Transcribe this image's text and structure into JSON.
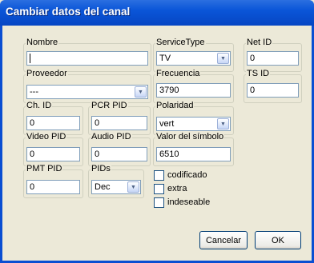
{
  "window": {
    "title": "Cambiar datos del canal"
  },
  "fields": {
    "nombre": {
      "label": "Nombre",
      "value": ""
    },
    "service_type": {
      "label": "ServiceType",
      "value": "TV"
    },
    "net_id": {
      "label": "Net ID",
      "value": "0"
    },
    "proveedor": {
      "label": "Proveedor",
      "value": "---"
    },
    "frecuencia": {
      "label": "Frecuencia",
      "value": "3790"
    },
    "ts_id": {
      "label": "TS ID",
      "value": "0"
    },
    "ch_id": {
      "label": "Ch. ID",
      "value": "0"
    },
    "pcr_pid": {
      "label": "PCR PID",
      "value": "0"
    },
    "polaridad": {
      "label": "Polaridad",
      "value": "vert"
    },
    "video_pid": {
      "label": "Video PID",
      "value": "0"
    },
    "audio_pid": {
      "label": "Audio PID",
      "value": "0"
    },
    "valor_simbolo": {
      "label": "Valor del símbolo",
      "value": "6510"
    },
    "pmt_pid": {
      "label": "PMT PID",
      "value": "0"
    },
    "pids": {
      "label": "PIDs",
      "value": "Dec"
    }
  },
  "checkboxes": {
    "codificado": {
      "label": "codificado",
      "checked": false
    },
    "extra": {
      "label": "extra",
      "checked": false
    },
    "indeseable": {
      "label": "indeseable",
      "checked": false
    }
  },
  "buttons": {
    "cancel": "Cancelar",
    "ok": "OK"
  },
  "icons": {
    "dropdown": "chevron-down-icon"
  }
}
